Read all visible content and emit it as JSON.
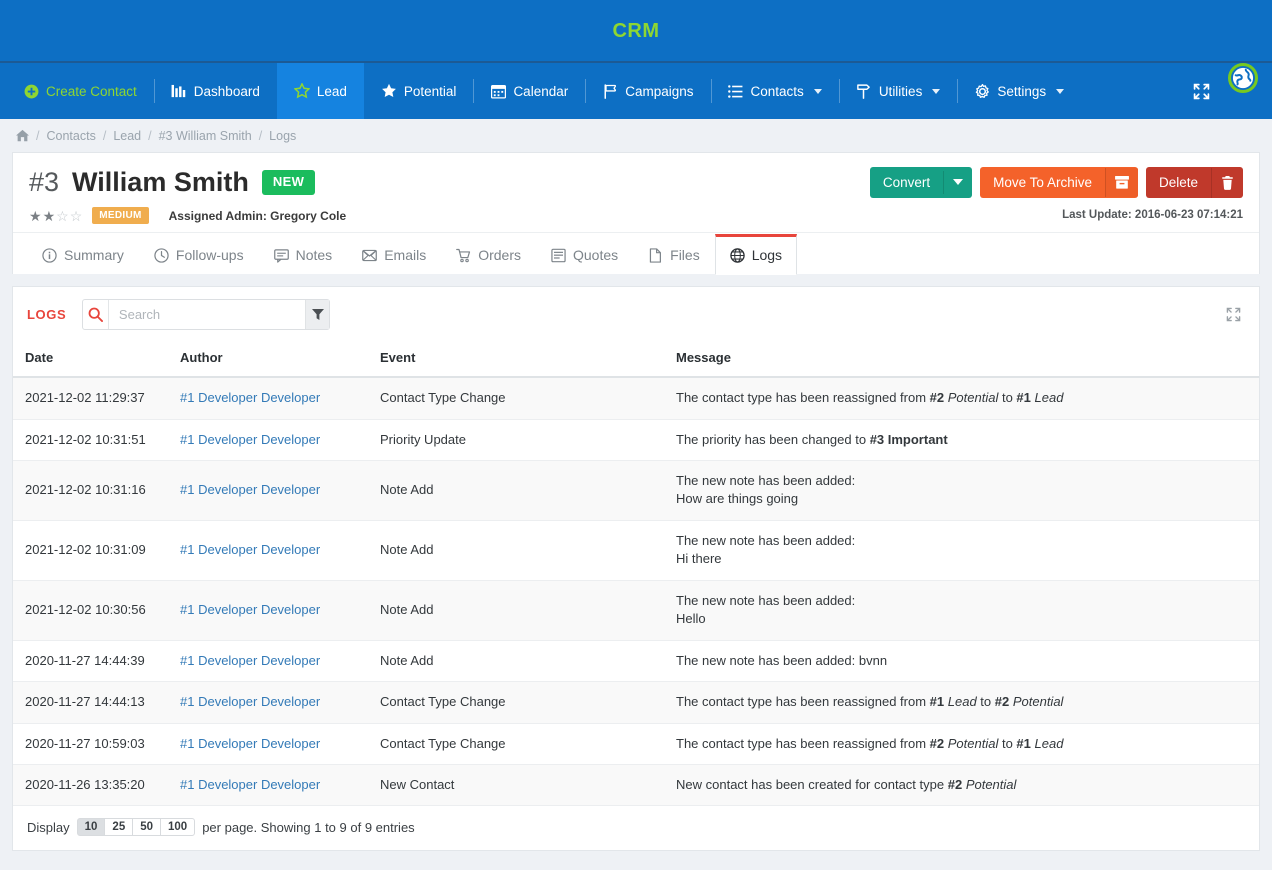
{
  "brand": {
    "name": "CRM"
  },
  "nav": {
    "items": [
      {
        "label": "Create Contact",
        "icon": "plus-circle-icon",
        "style": "green",
        "active": false,
        "caret": false
      },
      {
        "label": "Dashboard",
        "icon": "dashboard-icon",
        "style": "",
        "active": false,
        "caret": false
      },
      {
        "label": "Lead",
        "icon": "star-outline-icon",
        "style": "",
        "active": true,
        "caret": false
      },
      {
        "label": "Potential",
        "icon": "star-filled-icon",
        "style": "",
        "active": false,
        "caret": false
      },
      {
        "label": "Calendar",
        "icon": "calendar-icon",
        "style": "",
        "active": false,
        "caret": false
      },
      {
        "label": "Campaigns",
        "icon": "flag-icon",
        "style": "",
        "active": false,
        "caret": false
      },
      {
        "label": "Contacts",
        "icon": "list-icon",
        "style": "",
        "active": false,
        "caret": true
      },
      {
        "label": "Utilities",
        "icon": "signpost-icon",
        "style": "",
        "active": false,
        "caret": true
      },
      {
        "label": "Settings",
        "icon": "gear-icon",
        "style": "",
        "active": false,
        "caret": true
      }
    ],
    "fullscreen_icon": "expand-icon",
    "avatar_icon": "user-avatar-globe-icon"
  },
  "breadcrumb": {
    "home_icon": "home-icon",
    "items": [
      "Contacts",
      "Lead",
      "#3 William Smith",
      "Logs"
    ]
  },
  "header": {
    "record_number": "#3",
    "name": "William Smith",
    "status_badge": "NEW",
    "stars_filled": 2,
    "stars_total": 4,
    "priority_badge": "MEDIUM",
    "assigned_admin": "Assigned Admin: Gregory Cole",
    "last_update": "Last Update: 2016-06-23 07:14:21",
    "actions": {
      "convert": "Convert",
      "convert_caret_icon": "chevron-down-icon",
      "archive": "Move To Archive",
      "archive_icon": "archive-box-icon",
      "delete": "Delete",
      "delete_icon": "trash-icon"
    }
  },
  "tabs": [
    {
      "label": "Summary",
      "icon": "info-circle-icon",
      "active": false
    },
    {
      "label": "Follow-ups",
      "icon": "clock-icon",
      "active": false
    },
    {
      "label": "Notes",
      "icon": "note-icon",
      "active": false
    },
    {
      "label": "Emails",
      "icon": "envelope-icon",
      "active": false
    },
    {
      "label": "Orders",
      "icon": "cart-icon",
      "active": false
    },
    {
      "label": "Quotes",
      "icon": "document-icon",
      "active": false
    },
    {
      "label": "Files",
      "icon": "file-icon",
      "active": false
    },
    {
      "label": "Logs",
      "icon": "globe-icon",
      "active": true
    }
  ],
  "panel": {
    "title": "LOGS",
    "search": {
      "value": "",
      "placeholder": "Search",
      "search_icon": "search-icon",
      "filter_icon": "filter-icon"
    },
    "expand_icon": "expand-icon"
  },
  "table": {
    "columns": [
      "Date",
      "Author",
      "Event",
      "Message"
    ],
    "rows": [
      {
        "date": "2021-12-02 11:29:37",
        "author": "#1 Developer Developer",
        "event": "Contact Type Change",
        "message_parts": [
          {
            "t": "The contact type has been reassigned from ",
            "s": "n"
          },
          {
            "t": "#2",
            "s": "b"
          },
          {
            "t": " ",
            "s": "n"
          },
          {
            "t": "Potential",
            "s": "i"
          },
          {
            "t": " to ",
            "s": "n"
          },
          {
            "t": "#1",
            "s": "b"
          },
          {
            "t": " ",
            "s": "n"
          },
          {
            "t": "Lead",
            "s": "i"
          }
        ]
      },
      {
        "date": "2021-12-02 10:31:51",
        "author": "#1 Developer Developer",
        "event": "Priority Update",
        "message_parts": [
          {
            "t": "The priority has been changed to ",
            "s": "n"
          },
          {
            "t": "#3 Important",
            "s": "b"
          }
        ]
      },
      {
        "date": "2021-12-02 10:31:16",
        "author": "#1 Developer Developer",
        "event": "Note Add",
        "message_parts": [
          {
            "t": "The new note has been added:",
            "s": "n"
          },
          {
            "t": "How are things going",
            "s": "nl"
          }
        ]
      },
      {
        "date": "2021-12-02 10:31:09",
        "author": "#1 Developer Developer",
        "event": "Note Add",
        "message_parts": [
          {
            "t": "The new note has been added:",
            "s": "n"
          },
          {
            "t": "Hi there",
            "s": "nl"
          }
        ]
      },
      {
        "date": "2021-12-02 10:30:56",
        "author": "#1 Developer Developer",
        "event": "Note Add",
        "message_parts": [
          {
            "t": "The new note has been added:",
            "s": "n"
          },
          {
            "t": "Hello",
            "s": "nl"
          }
        ]
      },
      {
        "date": "2020-11-27 14:44:39",
        "author": "#1 Developer Developer",
        "event": "Note Add",
        "message_parts": [
          {
            "t": "The new note has been added: bvnn",
            "s": "n"
          }
        ]
      },
      {
        "date": "2020-11-27 14:44:13",
        "author": "#1 Developer Developer",
        "event": "Contact Type Change",
        "message_parts": [
          {
            "t": "The contact type has been reassigned from ",
            "s": "n"
          },
          {
            "t": "#1",
            "s": "b"
          },
          {
            "t": " ",
            "s": "n"
          },
          {
            "t": "Lead",
            "s": "i"
          },
          {
            "t": " to ",
            "s": "n"
          },
          {
            "t": "#2",
            "s": "b"
          },
          {
            "t": " ",
            "s": "n"
          },
          {
            "t": "Potential",
            "s": "i"
          }
        ]
      },
      {
        "date": "2020-11-27 10:59:03",
        "author": "#1 Developer Developer",
        "event": "Contact Type Change",
        "message_parts": [
          {
            "t": "The contact type has been reassigned from ",
            "s": "n"
          },
          {
            "t": "#2",
            "s": "b"
          },
          {
            "t": " ",
            "s": "n"
          },
          {
            "t": "Potential",
            "s": "i"
          },
          {
            "t": " to ",
            "s": "n"
          },
          {
            "t": "#1",
            "s": "b"
          },
          {
            "t": " ",
            "s": "n"
          },
          {
            "t": "Lead",
            "s": "i"
          }
        ]
      },
      {
        "date": "2020-11-26 13:35:20",
        "author": "#1 Developer Developer",
        "event": "New Contact",
        "message_parts": [
          {
            "t": "New contact has been created for contact type ",
            "s": "n"
          },
          {
            "t": "#2",
            "s": "b"
          },
          {
            "t": " ",
            "s": "n"
          },
          {
            "t": "Potential",
            "s": "i"
          }
        ]
      }
    ]
  },
  "footer": {
    "display_label": "Display",
    "page_sizes": [
      "10",
      "25",
      "50",
      "100"
    ],
    "active_page_size": "10",
    "summary": "per page. Showing 1 to 9 of 9 entries"
  },
  "colors": {
    "nav_blue": "#0d6fc4",
    "nav_active_blue": "#1583e0",
    "brand_green": "#8ed632",
    "badge_new_green": "#1bbc5d",
    "badge_medium_orange": "#f0ad4e",
    "convert_teal": "#16a085",
    "archive_orange": "#f4622a",
    "delete_red": "#c0392b",
    "accent_red": "#e8453c",
    "link_blue": "#337ab7"
  }
}
